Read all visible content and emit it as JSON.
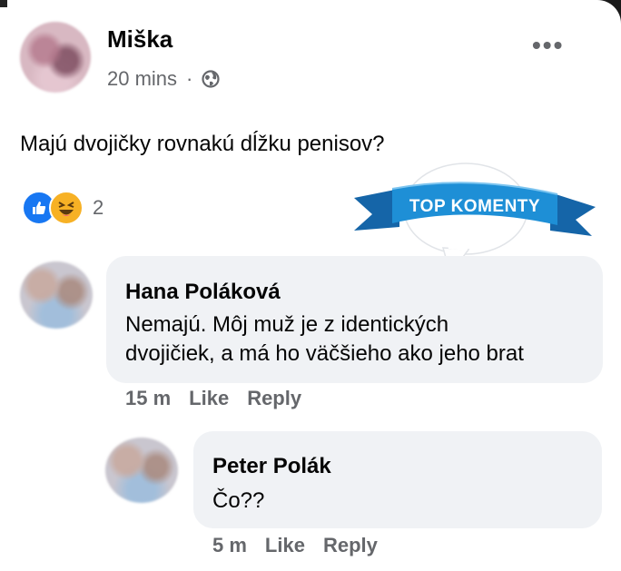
{
  "post": {
    "author": "Miška",
    "time": "20 mins",
    "separator": "·",
    "privacy_icon": "globe-icon",
    "text": "Majú dvojičky rovnakú dĺžku penisov?",
    "more_label": "•••",
    "reactions": {
      "icons": [
        "like-icon",
        "haha-icon"
      ],
      "count": "2"
    }
  },
  "badge": {
    "label": "TOP KOMENTY",
    "color": "#1e8fd6"
  },
  "comments": [
    {
      "author": "Hana Poláková",
      "text_lines": [
        "Nemajú. Môj muž je z identických",
        "dvojičiek, a má ho väčšieho ako jeho brat"
      ],
      "time": "15 m",
      "like": "Like",
      "reply": "Reply"
    },
    {
      "author": "Peter Polák",
      "text_lines": [
        "Čo??"
      ],
      "time": "5 m",
      "like": "Like",
      "reply": "Reply"
    }
  ],
  "colors": {
    "secondary_text": "#65676b",
    "bubble_bg": "#f0f2f5",
    "like_blue": "#1877f2",
    "haha_yellow": "#f7b125"
  }
}
